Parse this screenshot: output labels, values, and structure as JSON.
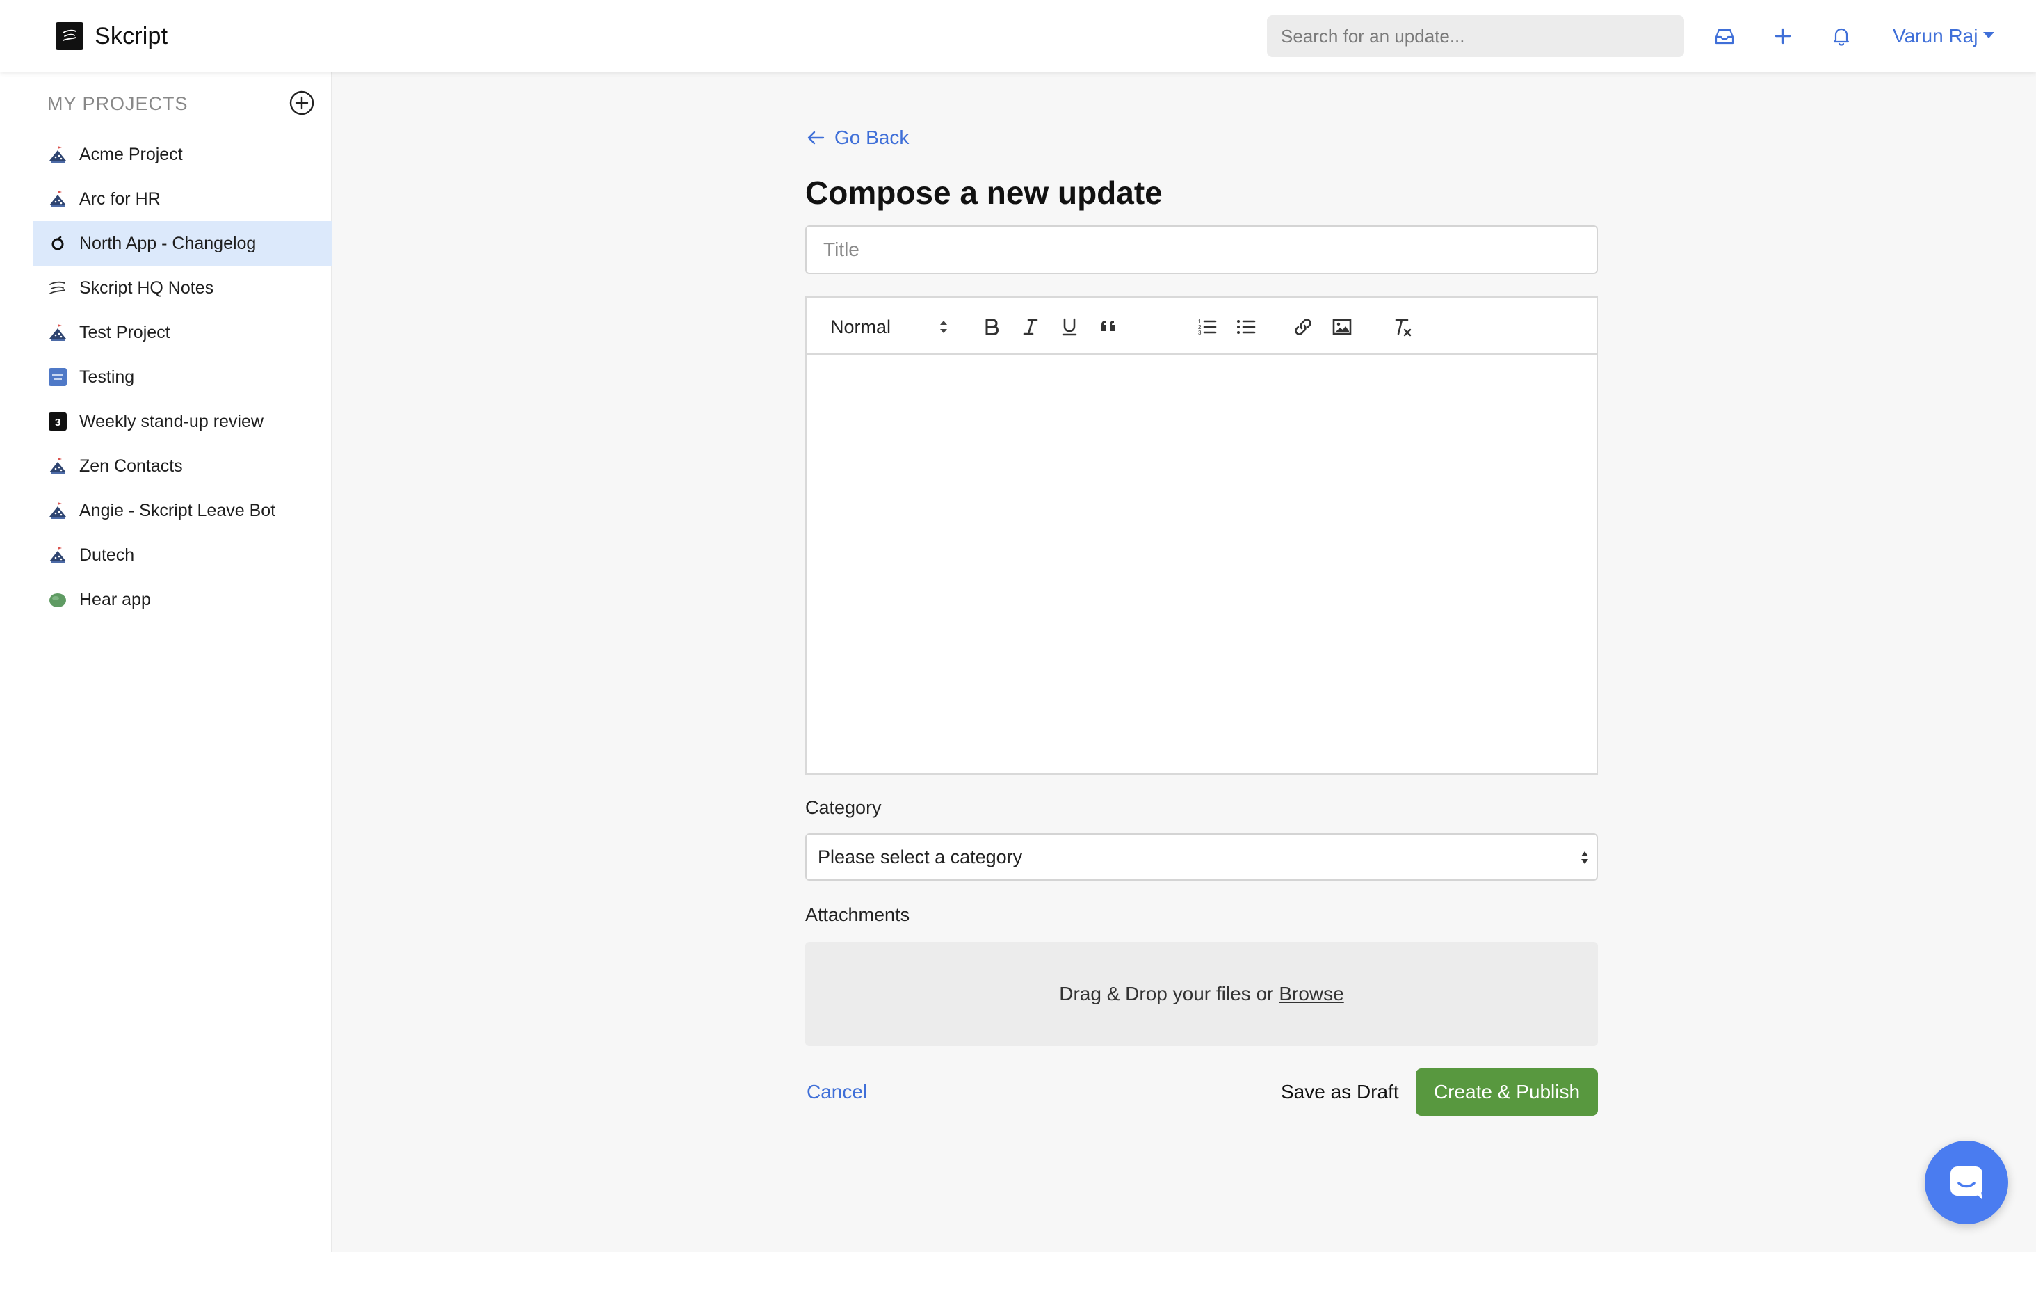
{
  "brand": {
    "name": "Skcript"
  },
  "header": {
    "search_placeholder": "Search for an update...",
    "user_name": "Varun Raj",
    "icons": [
      "inbox-icon",
      "plus-icon",
      "bell-icon"
    ]
  },
  "sidebar": {
    "header": "MY PROJECTS",
    "items": [
      {
        "label": "Acme Project",
        "icon": "project-hat-icon"
      },
      {
        "label": "Arc for HR",
        "icon": "project-hat-icon"
      },
      {
        "label": "North App - Changelog",
        "icon": "north-logo-icon",
        "active": true
      },
      {
        "label": "Skcript HQ Notes",
        "icon": "skcript-logo-icon"
      },
      {
        "label": "Test Project",
        "icon": "project-hat-icon"
      },
      {
        "label": "Testing",
        "icon": "testing-thumbnail-icon"
      },
      {
        "label": "Weekly stand-up review",
        "icon": "number-three-icon"
      },
      {
        "label": "Zen Contacts",
        "icon": "project-hat-icon"
      },
      {
        "label": "Angie - Skcript Leave Bot",
        "icon": "project-hat-icon"
      },
      {
        "label": "Dutech",
        "icon": "project-hat-icon"
      },
      {
        "label": "Hear app",
        "icon": "green-blob-icon"
      }
    ]
  },
  "main": {
    "go_back": "Go Back",
    "title": "Compose a new update",
    "title_placeholder": "Title",
    "editor": {
      "format_value": "Normal"
    },
    "category_label": "Category",
    "category_value": "Please select a category",
    "attachments_label": "Attachments",
    "dropzone_text": "Drag & Drop your files or",
    "browse": "Browse",
    "cancel": "Cancel",
    "save_draft": "Save as Draft",
    "publish": "Create & Publish"
  },
  "colors": {
    "accent": "#3f6fd8",
    "publish": "#58983f",
    "active_item": "#dce9fb",
    "chat": "#4a7cf0"
  }
}
